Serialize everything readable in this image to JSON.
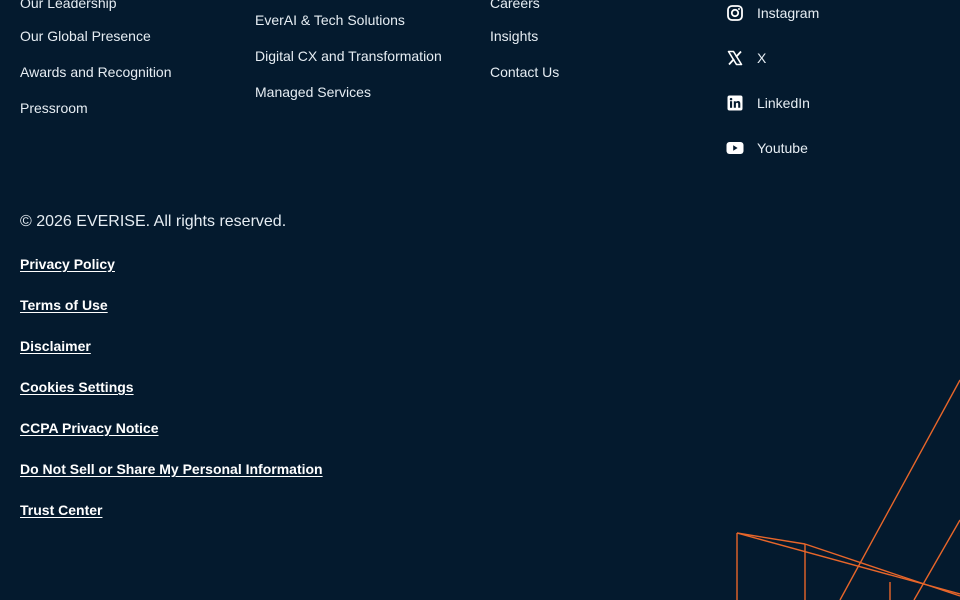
{
  "columns": {
    "company": {
      "links": [
        "Our Leadership",
        "Our Global Presence",
        "Awards and Recognition",
        "Pressroom"
      ]
    },
    "services": {
      "links": [
        "EverAI & Tech Solutions",
        "Digital CX and Transformation",
        "Managed Services"
      ]
    },
    "more": {
      "links": [
        "Careers",
        "Insights",
        "Contact Us"
      ]
    }
  },
  "social": {
    "items": [
      {
        "label": "Instagram",
        "icon": "instagram-icon"
      },
      {
        "label": "X",
        "icon": "x-icon"
      },
      {
        "label": "LinkedIn",
        "icon": "linkedin-icon"
      },
      {
        "label": "Youtube",
        "icon": "youtube-icon"
      }
    ]
  },
  "footer": {
    "copyright": "© 2026 EVERISE. All rights reserved.",
    "legal_links": [
      "Privacy Policy",
      "Terms of Use",
      "Disclaimer",
      "Cookies Settings",
      "CCPA Privacy Notice",
      "Do Not Sell or Share My Personal Information",
      "Trust Center"
    ]
  },
  "colors": {
    "background": "#041a2e",
    "text": "#e6edf3",
    "accent": "#e8662a"
  }
}
